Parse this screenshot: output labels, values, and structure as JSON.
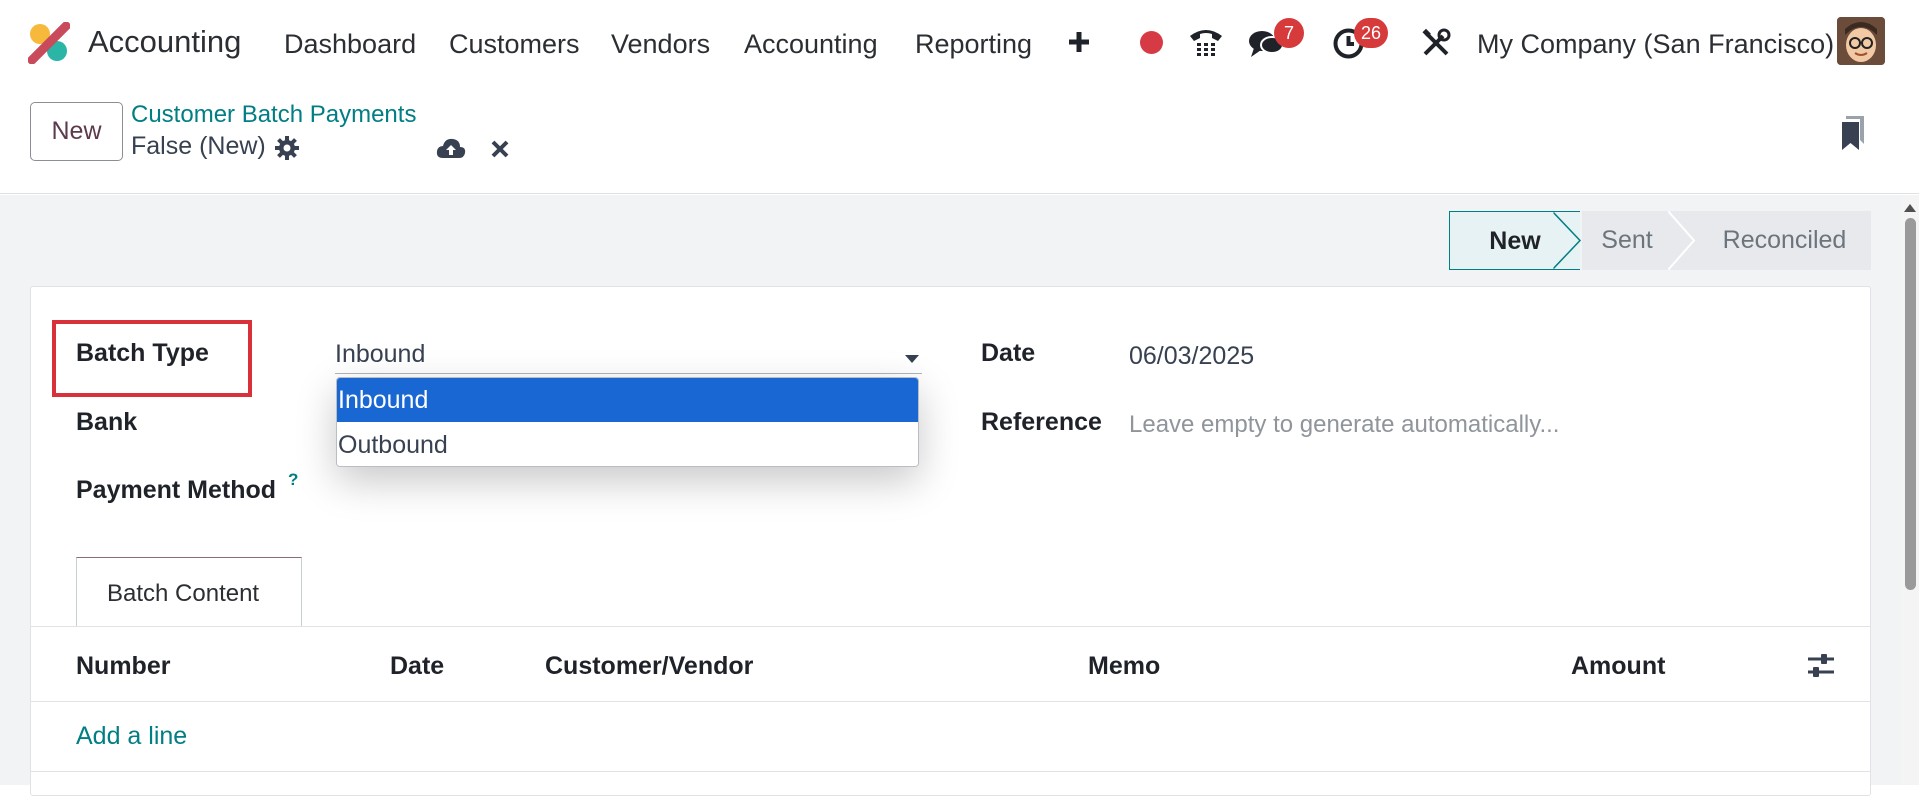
{
  "nav": {
    "app_title": "Accounting",
    "menu": [
      "Dashboard",
      "Customers",
      "Vendors",
      "Accounting",
      "Reporting"
    ],
    "chat_count": "7",
    "activity_count": "26",
    "company": "My Company (San Francisco)"
  },
  "control": {
    "new_label": "New",
    "breadcrumb_parent": "Customer Batch Payments",
    "record_name": "False (New)"
  },
  "status_stages": [
    "New",
    "Sent",
    "Reconciled"
  ],
  "form": {
    "batch_type_label": "Batch Type",
    "batch_type_value": "Inbound",
    "bank_label": "Bank",
    "payment_method_label": "Payment Method",
    "payment_method_help": "?",
    "date_label": "Date",
    "date_value": "06/03/2025",
    "reference_label": "Reference",
    "reference_placeholder": "Leave empty to generate automatically..."
  },
  "dropdown_options": [
    "Inbound",
    "Outbound"
  ],
  "tab_label": "Batch Content",
  "table": {
    "columns": [
      "Number",
      "Date",
      "Customer/Vendor",
      "Memo",
      "Amount"
    ],
    "add_line": "Add a line"
  },
  "colors": {
    "accent_teal": "#017e84",
    "selected_option": "#1967d2",
    "highlight_box": "#d93139",
    "badge": "#d63a3a"
  }
}
